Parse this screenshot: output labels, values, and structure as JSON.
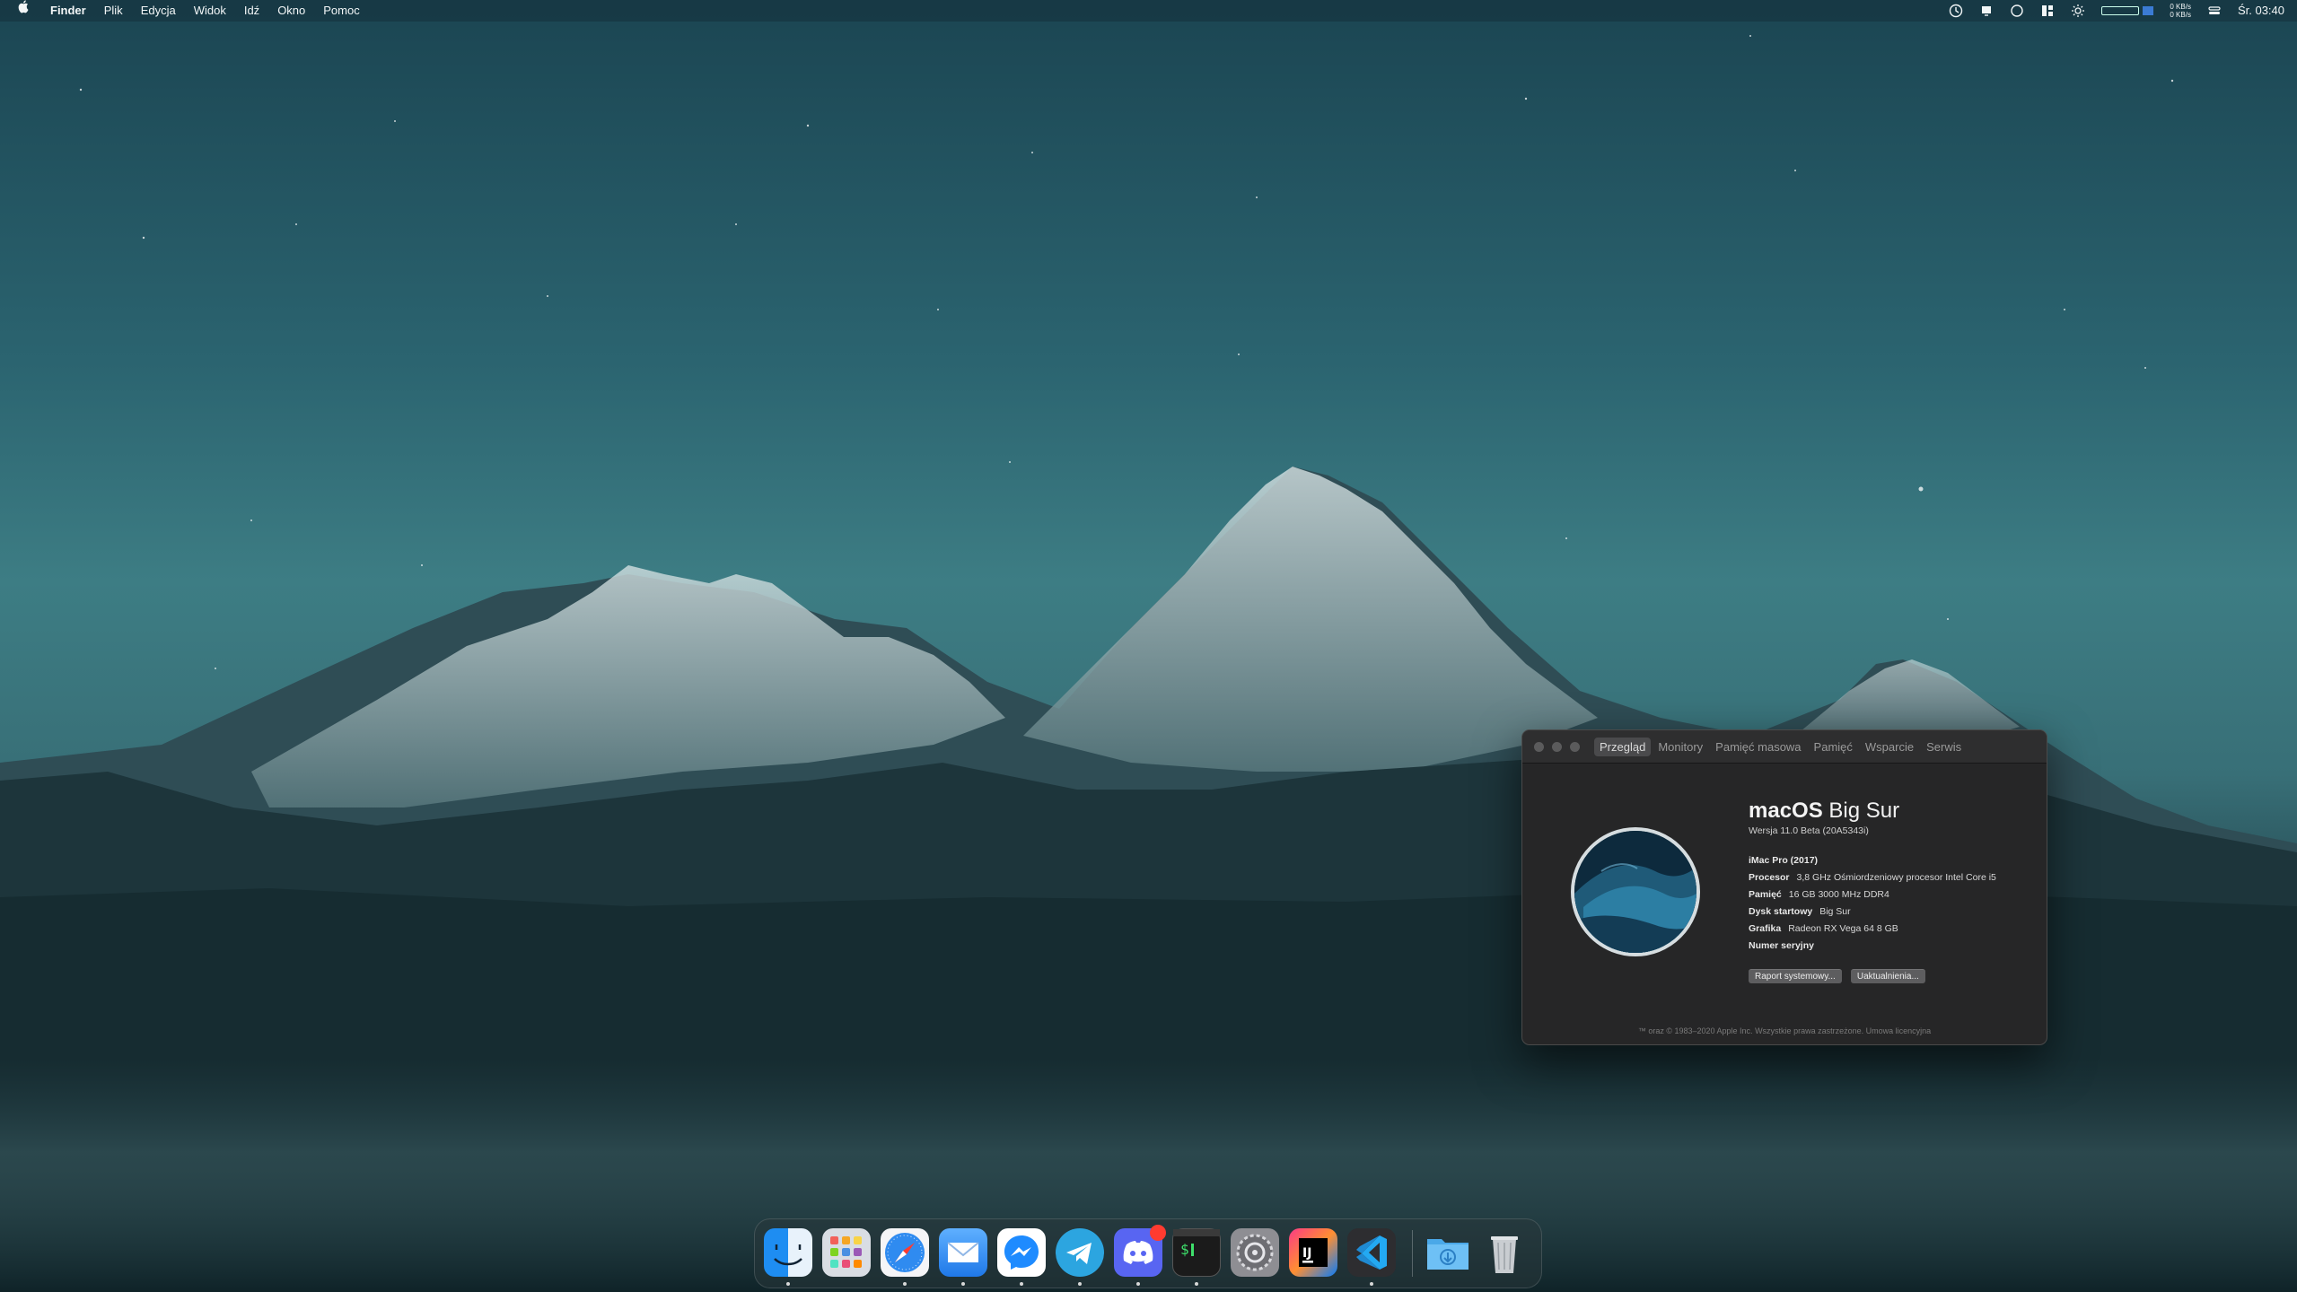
{
  "menubar": {
    "app_name": "Finder",
    "menus": [
      "Plik",
      "Edycja",
      "Widok",
      "Idź",
      "Okno",
      "Pomoc"
    ],
    "net_up": "0 KB/s",
    "net_down": "0 KB/s",
    "clock": "Śr. 03:40"
  },
  "about": {
    "tabs": [
      "Przegląd",
      "Monitory",
      "Pamięć masowa",
      "Pamięć",
      "Wsparcie",
      "Serwis"
    ],
    "active_tab": "Przegląd",
    "os_name_bold": "macOS",
    "os_name_light": "Big Sur",
    "version": "Wersja 11.0 Beta (20A5343i)",
    "model": "iMac Pro (2017)",
    "specs": [
      {
        "label": "Procesor",
        "value": "3,8 GHz Ośmiordzeniowy procesor Intel Core i5"
      },
      {
        "label": "Pamięć",
        "value": "16 GB 3000 MHz DDR4"
      },
      {
        "label": "Dysk startowy",
        "value": "Big Sur"
      },
      {
        "label": "Grafika",
        "value": "Radeon RX Vega 64 8  GB"
      },
      {
        "label": "Numer seryjny",
        "value": ""
      }
    ],
    "buttons": {
      "report": "Raport systemowy...",
      "updates": "Uaktualnienia..."
    },
    "footer": "™ oraz © 1983–2020 Apple Inc. Wszystkie prawa zastrzeżone. Umowa licencyjna"
  },
  "dock": {
    "apps": [
      "finder",
      "launchpad",
      "safari",
      "mail",
      "messenger",
      "telegram",
      "discord",
      "terminal",
      "system-preferences",
      "intellij-idea",
      "vscode",
      "downloads",
      "trash"
    ],
    "colors": {
      "discord_badge": "#ff3b30"
    }
  }
}
